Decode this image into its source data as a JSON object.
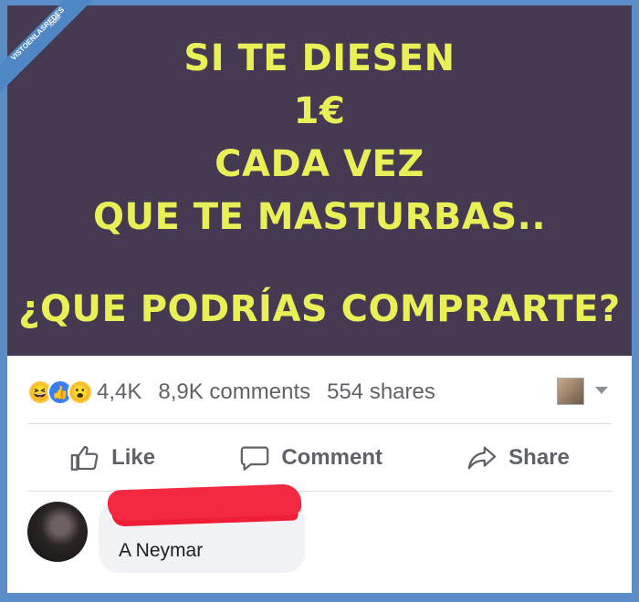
{
  "meme": {
    "lines": [
      "SI TE DIESEN",
      "1€",
      "CADA VEZ",
      "QUE TE MASTURBAS..",
      "¿QUE PODRÍAS COMPRARTE?"
    ],
    "bg_color": "#463a52",
    "text_color": "#e9ef57"
  },
  "watermark": {
    "main": "VISTOENLASREDES",
    "sub": ".com"
  },
  "stats": {
    "reactions": [
      "haha-icon",
      "like-icon",
      "wow-icon"
    ],
    "reactions_count": "4,4K",
    "comments": "8,9K comments",
    "shares": "554 shares"
  },
  "actions": {
    "like": "Like",
    "comment": "Comment",
    "share": "Share"
  },
  "comment": {
    "text": "A Neymar"
  }
}
